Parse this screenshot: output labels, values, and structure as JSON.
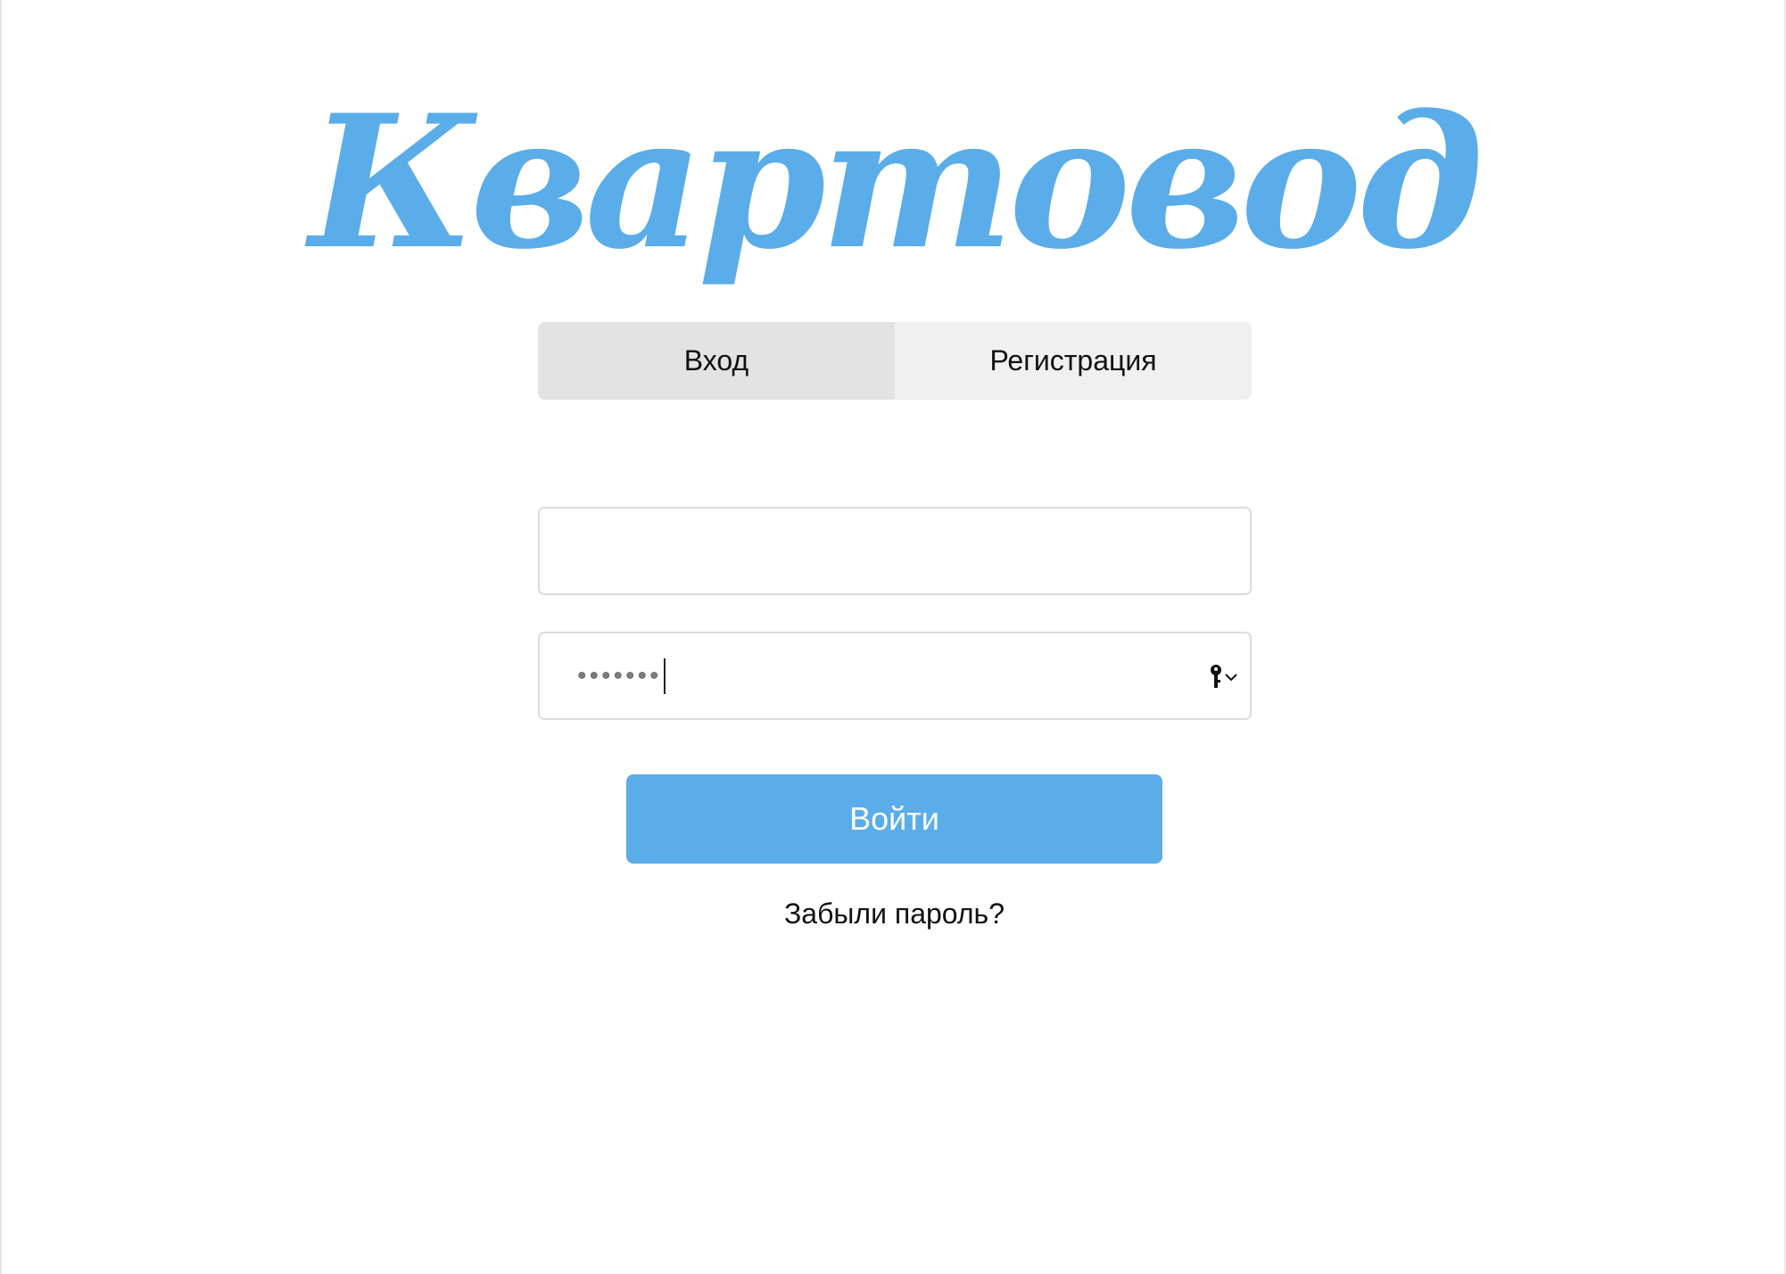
{
  "brand": {
    "logo_text": "Квартовод",
    "color": "#5aade8"
  },
  "tabs": [
    {
      "label": "Вход",
      "active": true
    },
    {
      "label": "Регистрация",
      "active": false
    }
  ],
  "form": {
    "login_value": "",
    "password_mask": "•••••••",
    "password_autofill_icon": "key-icon"
  },
  "actions": {
    "submit_label": "Войти",
    "forgot_label": "Забыли пароль?"
  }
}
